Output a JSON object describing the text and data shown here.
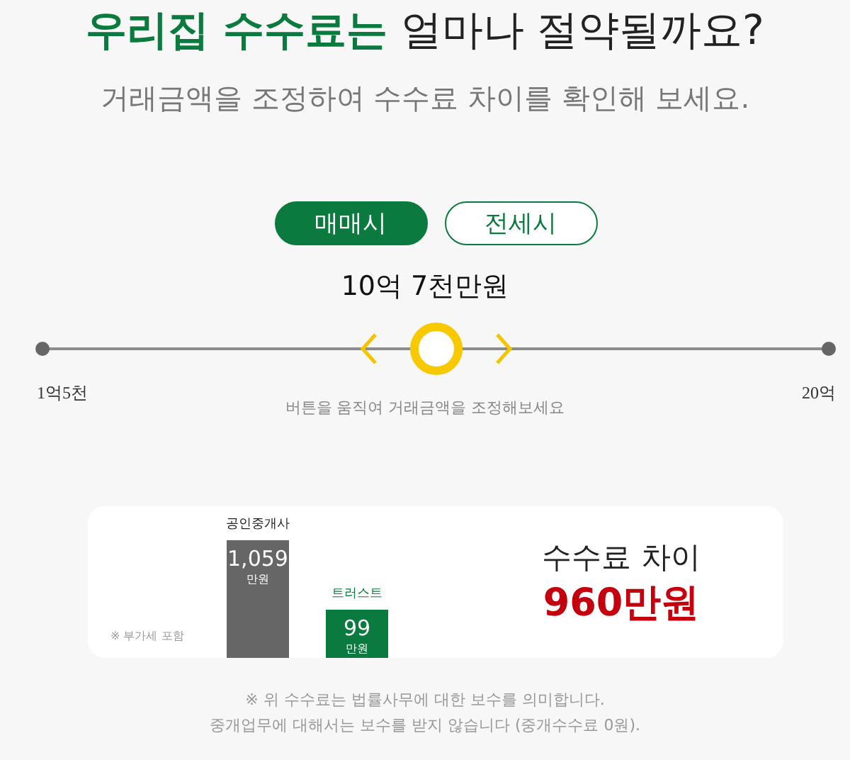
{
  "header": {
    "title_highlight": "우리집 수수료는",
    "title_rest": "얼마나 절약될까요?",
    "subtitle": "거래금액을 조정하여 수수료 차이를 확인해 보세요."
  },
  "tabs": [
    {
      "label": "매매시",
      "selected": true
    },
    {
      "label": "전세시",
      "selected": false
    }
  ],
  "slider": {
    "value": "10억 7천만원",
    "level": 0.5,
    "min_label": "1억5천",
    "max_label": "20억",
    "hint": "버튼을 움직여 거래금액을 조정해보세요"
  },
  "comparison": {
    "vat_note": "※ 부가세 포함",
    "bars": [
      {
        "kind": "tall",
        "label": "공인중개사",
        "value": "1,059",
        "unit": "만원",
        "color": "#666666"
      },
      {
        "kind": "short",
        "label": "트러스트",
        "value": "99",
        "unit": "만원",
        "color": "#0b7a3e"
      }
    ],
    "difference_label": "수수료 차이",
    "difference_value": "960만원"
  },
  "footnotes": [
    "※ 위 수수료는 법률사무에 대한 보수를 의미합니다.",
    "중개업무에 대해서는 보수를 받지 않습니다 (중개수수료 0원)."
  ]
}
